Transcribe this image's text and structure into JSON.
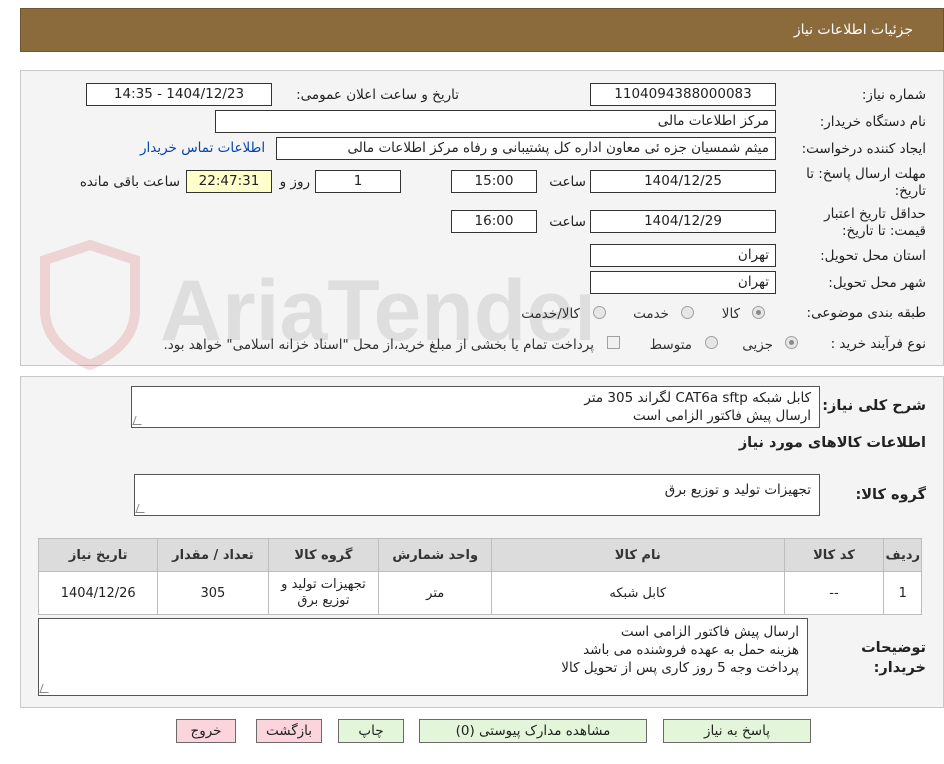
{
  "header": {
    "title": "جزئیات اطلاعات نیاز"
  },
  "watermark": {
    "text": "AriaTender.neT"
  },
  "form": {
    "need_number_label": "شماره نیاز:",
    "need_number": "1104094388000083",
    "announce_label": "تاریخ و ساعت اعلان عمومی:",
    "announce_value": "1404/12/23 - 14:35",
    "buyer_org_label": "نام دستگاه خریدار:",
    "buyer_org": "مرکز اطلاعات مالی",
    "requester_label": "ایجاد کننده درخواست:",
    "requester": "میثم شمسیان جزه ئی معاون اداره کل پشتیبانی و رفاه مرکز اطلاعات مالی",
    "contact_link": "اطلاعات تماس خریدار",
    "deadline_label": "مهلت ارسال پاسخ: تا تاریخ:",
    "deadline_date": "1404/12/25",
    "time_label": "ساعت",
    "deadline_time": "15:00",
    "days": "1",
    "days_label": "روز و",
    "remaining": "22:47:31",
    "remaining_label": "ساعت باقی مانده",
    "validity_label": "حداقل تاریخ اعتبار قیمت: تا تاریخ:",
    "validity_date": "1404/12/29",
    "validity_time": "16:00",
    "province_label": "استان محل تحویل:",
    "province": "تهران",
    "city_label": "شهر محل تحویل:",
    "city": "تهران",
    "category_label": "طبقه بندی موضوعی:",
    "category_options": [
      "کالا",
      "خدمت",
      "کالا/خدمت"
    ],
    "category_selected": 0,
    "purchase_type_label": "نوع فرآیند خرید :",
    "purchase_options": [
      "جزیی",
      "متوسط"
    ],
    "purchase_selected": 0,
    "payment_note": "پرداخت تمام یا بخشی از مبلغ خرید،از محل \"اسناد خزانه اسلامی\" خواهد بود."
  },
  "summary": {
    "label": "شرح کلی نیاز:",
    "line1": "کابل شبکه CAT6a sftp لگراند 305 متر",
    "line2": "ارسال پیش فاکتور الزامی است"
  },
  "goods": {
    "section_title": "اطلاعات کالاهای مورد نیاز",
    "group_label": "گروه کالا:",
    "group_value": "تجهیزات تولید و توزیع برق"
  },
  "table": {
    "headers": [
      "ردیف",
      "کد کالا",
      "نام کالا",
      "واحد شمارش",
      "گروه کالا",
      "تعداد / مقدار",
      "تاریخ نیاز"
    ],
    "rows": [
      [
        "1",
        "--",
        "کابل شبکه",
        "متر",
        "تجهیزات تولید و توزیع برق",
        "305",
        "1404/12/26"
      ]
    ]
  },
  "buyer_notes": {
    "label": "توضیحات خریدار:",
    "line1": "ارسال پیش فاکتور الزامی است",
    "line2": "هزینه حمل به عهده فروشنده می باشد",
    "line3": "پرداخت وجه 5 روز کاری پس از تحویل کالا"
  },
  "buttons": {
    "reply": "پاسخ به نیاز",
    "attachments": "مشاهده مدارک پیوستی (0)",
    "print": "چاپ",
    "back": "بازگشت",
    "exit": "خروج"
  },
  "colors": {
    "header_bg": "#8b6a3c",
    "link": "#0645ad",
    "button_green": "#e4f6d9",
    "button_pink": "#fbd4dc"
  }
}
